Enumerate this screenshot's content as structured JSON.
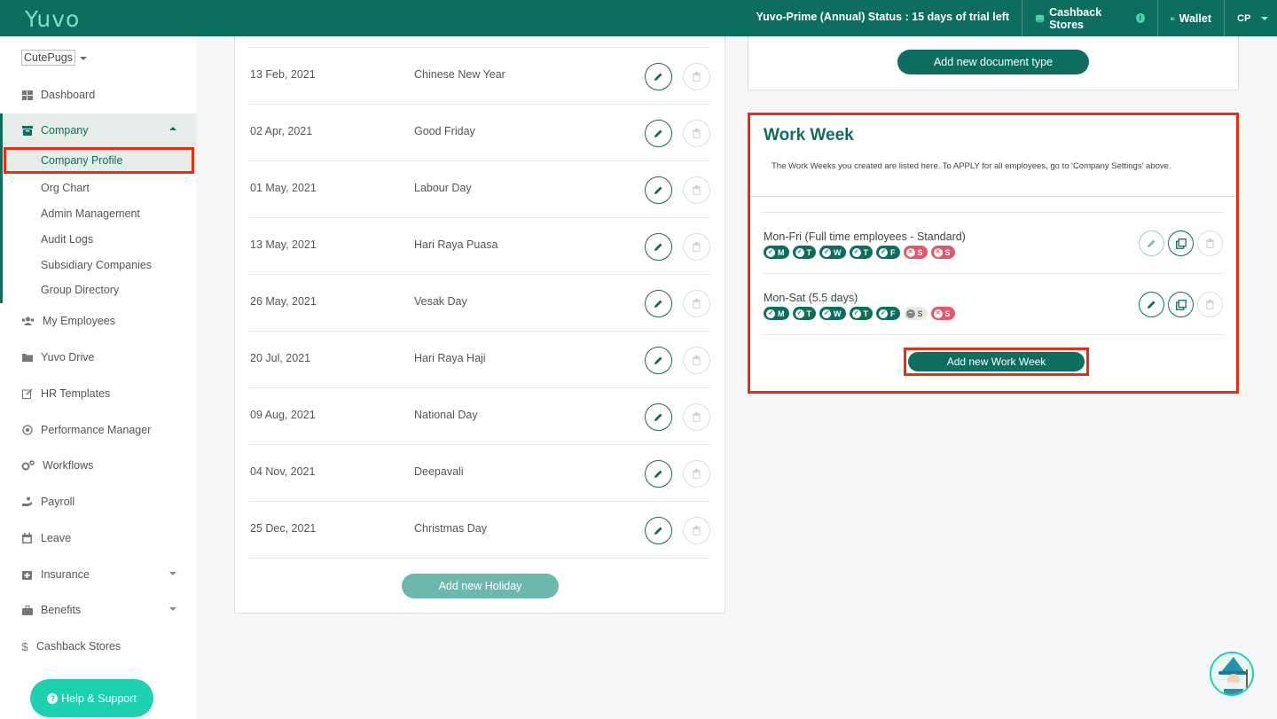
{
  "topbar": {
    "logo": "Yuvo",
    "status": "Yuvo-Prime (Annual) Status : 15 days of trial left",
    "cashback": "Cashback Stores",
    "wallet": "Wallet",
    "user": "CP"
  },
  "sidebar": {
    "company_name": "CutePugs",
    "dashboard": "Dashboard",
    "company": "Company",
    "company_sub": [
      "Company Profile",
      "Org Chart",
      "Admin Management",
      "Audit Logs",
      "Subsidiary Companies",
      "Group Directory"
    ],
    "items": [
      "My Employees",
      "Yuvo Drive",
      "HR Templates",
      "Performance Manager",
      "Workflows",
      "Payroll",
      "Leave",
      "Insurance",
      "Benefits",
      "Cashback Stores"
    ],
    "help": "Help & Support"
  },
  "holidays": {
    "rows": [
      {
        "date": "13 Feb, 2021",
        "name": "Chinese New Year"
      },
      {
        "date": "02 Apr, 2021",
        "name": "Good Friday"
      },
      {
        "date": "01 May, 2021",
        "name": "Labour Day"
      },
      {
        "date": "13 May, 2021",
        "name": "Hari Raya Puasa"
      },
      {
        "date": "26 May, 2021",
        "name": "Vesak Day"
      },
      {
        "date": "20 Jul, 2021",
        "name": "Hari Raya Haji"
      },
      {
        "date": "09 Aug, 2021",
        "name": "National Day"
      },
      {
        "date": "04 Nov, 2021",
        "name": "Deepavali"
      },
      {
        "date": "25 Dec, 2021",
        "name": "Christmas Day"
      }
    ],
    "add_label": "Add new Holiday"
  },
  "documents": {
    "add_label": "Add new document type"
  },
  "work_week": {
    "title": "Work Week",
    "description": "The Work Weeks you created are listed here. To APPLY for all employees, go to 'Company Settings' above.",
    "weeks": [
      {
        "name": "Mon-Fri (Full time employees - Standard)",
        "days": [
          {
            "l": "M",
            "s": "on"
          },
          {
            "l": "T",
            "s": "on"
          },
          {
            "l": "W",
            "s": "on"
          },
          {
            "l": "T",
            "s": "on"
          },
          {
            "l": "F",
            "s": "on"
          },
          {
            "l": "S",
            "s": "off"
          },
          {
            "l": "S",
            "s": "off"
          }
        ]
      },
      {
        "name": "Mon-Sat (5.5 days)",
        "days": [
          {
            "l": "M",
            "s": "on"
          },
          {
            "l": "T",
            "s": "on"
          },
          {
            "l": "W",
            "s": "on"
          },
          {
            "l": "T",
            "s": "on"
          },
          {
            "l": "F",
            "s": "on"
          },
          {
            "l": "S",
            "s": "half"
          },
          {
            "l": "S",
            "s": "off"
          }
        ]
      }
    ],
    "add_label": "Add new Work Week"
  }
}
